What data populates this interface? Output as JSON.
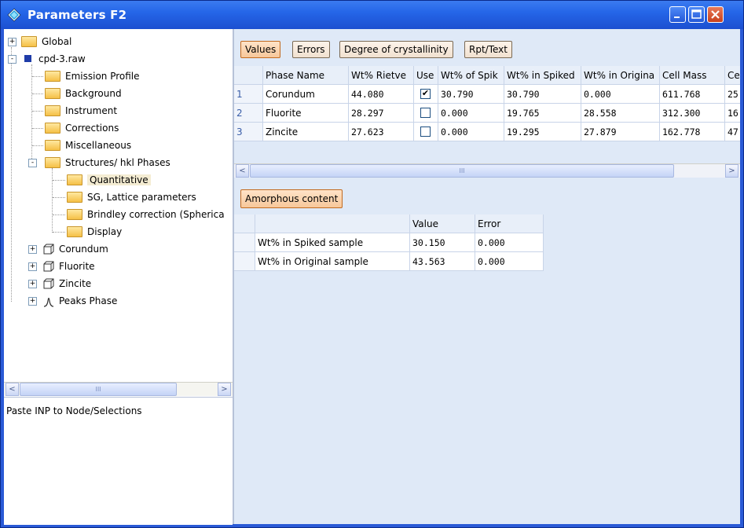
{
  "window": {
    "title": "Parameters F2",
    "accent": "#2566e8"
  },
  "tree": {
    "items": [
      {
        "label": "Global",
        "expander": "+"
      },
      {
        "label": "cpd-3.raw",
        "expander": "-"
      },
      {
        "label": "Emission Profile"
      },
      {
        "label": "Background"
      },
      {
        "label": "Instrument"
      },
      {
        "label": "Corrections"
      },
      {
        "label": "Miscellaneous"
      },
      {
        "label": "Structures/ hkl Phases",
        "expander": "-"
      },
      {
        "label": "Quantitative",
        "selected": true
      },
      {
        "label": "SG, Lattice parameters"
      },
      {
        "label": "Brindley correction (Spherica"
      },
      {
        "label": "Display"
      },
      {
        "label": "Corundum",
        "expander": "+"
      },
      {
        "label": "Fluorite",
        "expander": "+"
      },
      {
        "label": "Zincite",
        "expander": "+"
      },
      {
        "label": "Peaks Phase",
        "expander": "+"
      }
    ]
  },
  "left_bottom": {
    "text": "Paste INP to Node/Selections"
  },
  "toolbar": {
    "values": "Values",
    "errors": "Errors",
    "degree": "Degree of crystallinity",
    "rpt": "Rpt/Text"
  },
  "phase_table": {
    "headers": [
      "Phase Name",
      "Wt% Rietve",
      "Use",
      "Wt% of Spik",
      "Wt% in Spiked",
      "Wt% in Origina",
      "Cell Mass",
      "Ce"
    ],
    "rows": [
      {
        "num": "1",
        "name": "Corundum",
        "rietveld": "44.080",
        "use": true,
        "spike": "30.790",
        "spiked": "30.790",
        "orig": "0.000",
        "mass": "611.768",
        "cell": "25"
      },
      {
        "num": "2",
        "name": "Fluorite",
        "rietveld": "28.297",
        "use": false,
        "spike": "0.000",
        "spiked": "19.765",
        "orig": "28.558",
        "mass": "312.300",
        "cell": "16"
      },
      {
        "num": "3",
        "name": "Zincite",
        "rietveld": "27.623",
        "use": false,
        "spike": "0.000",
        "spiked": "19.295",
        "orig": "27.879",
        "mass": "162.778",
        "cell": "47"
      }
    ]
  },
  "amorphous": {
    "button": "Amorphous content",
    "headers": [
      "Value",
      "Error"
    ],
    "rows": [
      {
        "label": "Wt% in Spiked sample",
        "value": "30.150",
        "error": "0.000"
      },
      {
        "label": "Wt% in Original sample",
        "value": "43.563",
        "error": "0.000"
      }
    ]
  },
  "scroll": {
    "thumb_glyph": "III",
    "left": "<",
    "right": ">"
  },
  "icons": {
    "app": "diamond-icon",
    "minimize": "minimize-icon",
    "maximize": "maximize-icon",
    "close": "close-icon"
  }
}
